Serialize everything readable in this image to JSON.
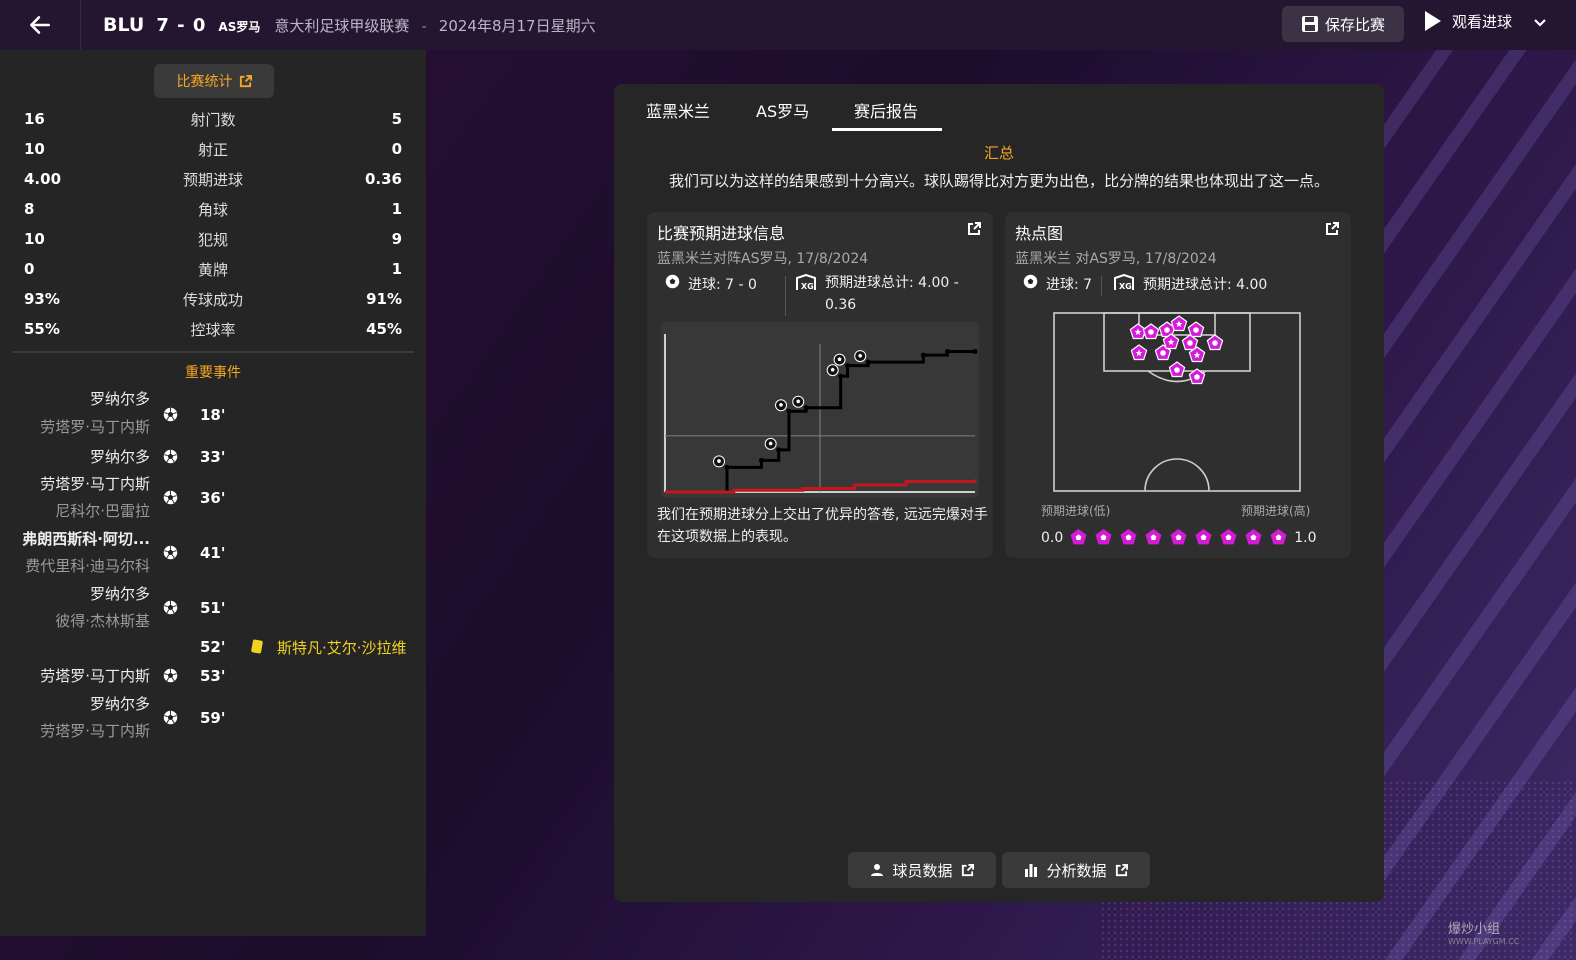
{
  "header": {
    "team": "BLU",
    "score": "7 - 0",
    "opponent": "AS罗马",
    "league": "意大利足球甲级联赛",
    "separator": "-",
    "date": "2024年8月17日星期六",
    "save_label": "保存比赛",
    "watch_label": "观看进球"
  },
  "stats": {
    "button_label": "比赛统计",
    "rows": [
      {
        "home": "16",
        "label": "射门数",
        "away": "5"
      },
      {
        "home": "10",
        "label": "射正",
        "away": "0"
      },
      {
        "home": "4.00",
        "label": "预期进球",
        "away": "0.36"
      },
      {
        "home": "8",
        "label": "角球",
        "away": "1"
      },
      {
        "home": "10",
        "label": "犯规",
        "away": "9"
      },
      {
        "home": "0",
        "label": "黄牌",
        "away": "1"
      },
      {
        "home": "93%",
        "label": "传球成功",
        "away": "91%"
      },
      {
        "home": "55%",
        "label": "控球率",
        "away": "45%"
      }
    ]
  },
  "events": {
    "title": "重要事件",
    "items": [
      {
        "player": "罗纳尔多",
        "assist": "劳塔罗·马丁内斯",
        "minute": "18'"
      },
      {
        "player": "罗纳尔多",
        "assist": "",
        "minute": "33'"
      },
      {
        "player": "劳塔罗·马丁内斯",
        "assist": "尼科尔·巴雷拉",
        "minute": "36'"
      },
      {
        "player": "弗朗西斯科·阿切...",
        "assist": "费代里科·迪马尔科",
        "minute": "41'"
      },
      {
        "player": "罗纳尔多",
        "assist": "彼得·杰林斯基",
        "minute": "51'"
      },
      {
        "minute": "52'",
        "card_player": "斯特凡·艾尔·沙拉维"
      },
      {
        "player": "劳塔罗·马丁内斯",
        "assist": "",
        "minute": "53'"
      },
      {
        "player": "罗纳尔多",
        "assist": "劳塔罗·马丁内斯",
        "minute": "59'"
      }
    ]
  },
  "main": {
    "tabs": [
      "蓝黑米兰",
      "AS罗马",
      "赛后报告"
    ],
    "active_tab": "赛后报告",
    "summary_title": "汇总",
    "summary_text": "我们可以为这样的结果感到十分高兴。球队踢得比对方更为出色，比分牌的结果也体现出了这一点。",
    "xg_card": {
      "title": "比赛预期进球信息",
      "subtitle": "蓝黑米兰对阵AS罗马, 17/8/2024",
      "goals": "进球: 7 - 0",
      "xg_total_line1": "预期进球总计: 4.00 -",
      "xg_total_line2": "0.36",
      "description": "我们在预期进球分上交出了优异的答卷, 远远完爆对手在这项数据上的表现。"
    },
    "heatmap_card": {
      "title": "热点图",
      "subtitle": "蓝黑米兰 对AS罗马, 17/8/2024",
      "goals": "进球: 7",
      "xg_total": "预期进球总计: 4.00",
      "low_label": "预期进球(低)",
      "high_label": "预期进球(高)",
      "scale_min": "0.0",
      "scale_max": "1.0"
    },
    "player_data_label": "球员数据",
    "analysis_label": "分析数据"
  },
  "chart_data": {
    "type": "line",
    "title": "比赛预期进球信息",
    "xlabel": "",
    "ylabel": "",
    "xlim": [
      0,
      90
    ],
    "ylim": [
      0,
      4.5
    ],
    "series": [
      {
        "name": "蓝黑米兰",
        "x": [
          0,
          18,
          28,
          33,
          36,
          41,
          51,
          53,
          59,
          75,
          82,
          90
        ],
        "values": [
          0,
          0.7,
          0.9,
          1.2,
          2.3,
          2.4,
          3.3,
          3.6,
          3.7,
          3.9,
          4.0,
          4.0
        ]
      },
      {
        "name": "AS罗马",
        "x": [
          0,
          20,
          40,
          55,
          70,
          90
        ],
        "values": [
          0,
          0.05,
          0.1,
          0.2,
          0.3,
          0.36
        ]
      }
    ],
    "goals_x": [
      18,
      33,
      36,
      41,
      51,
      53,
      59
    ]
  },
  "colors": {
    "accent": "#f5a623",
    "home_line": "#000000",
    "away_line": "#c4161c",
    "shot_marker": "#d31bd8",
    "card_yellow": "#f3d321"
  },
  "watermark": {
    "line1": "爆炒小组",
    "line2": "WWW.PLAYGM.CC"
  }
}
